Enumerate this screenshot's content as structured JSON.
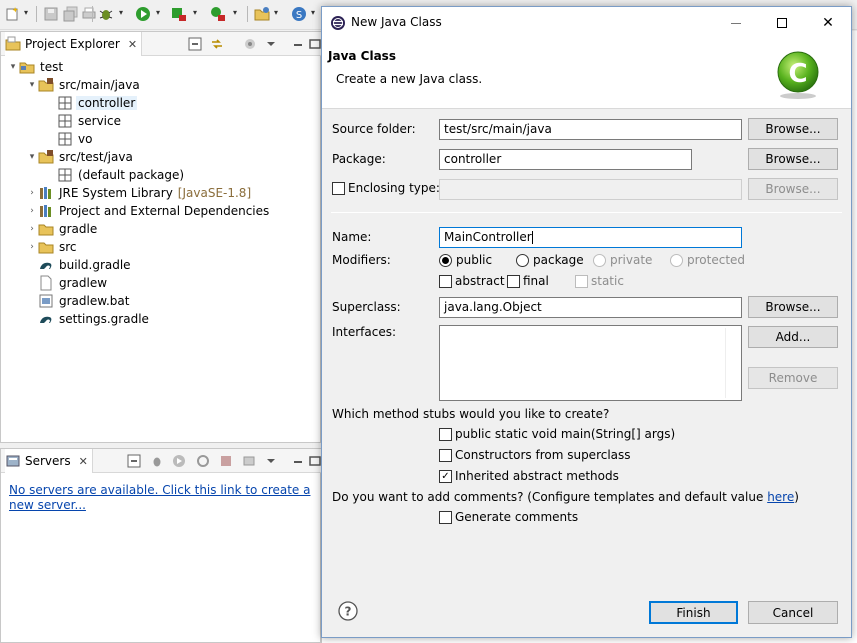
{
  "explorer": {
    "tab_label": "Project Explorer",
    "tree": [
      {
        "label": "test",
        "icon": "project-icon",
        "arrow": "▾",
        "level": 0
      },
      {
        "label": "src/main/java",
        "icon": "source-folder-icon",
        "arrow": "▾",
        "level": 1
      },
      {
        "label": "controller",
        "icon": "package-icon",
        "arrow": "",
        "level": 2,
        "selected": true
      },
      {
        "label": "service",
        "icon": "package-icon",
        "arrow": "",
        "level": 2
      },
      {
        "label": "vo",
        "icon": "package-icon",
        "arrow": "",
        "level": 2
      },
      {
        "label": "src/test/java",
        "icon": "source-folder-icon",
        "arrow": "▾",
        "level": 1
      },
      {
        "label": "(default package)",
        "icon": "package-icon",
        "arrow": "",
        "level": 2
      },
      {
        "label": "JRE System Library",
        "decor": "[JavaSE-1.8]",
        "icon": "library-icon",
        "arrow": "›",
        "level": 1
      },
      {
        "label": "Project and External Dependencies",
        "icon": "library-icon",
        "arrow": "›",
        "level": 1
      },
      {
        "label": "gradle",
        "icon": "folder-icon",
        "arrow": "›",
        "level": 1
      },
      {
        "label": "src",
        "icon": "folder-icon",
        "arrow": "›",
        "level": 1
      },
      {
        "label": "build.gradle",
        "icon": "gradle-file-icon",
        "arrow": "",
        "level": 1
      },
      {
        "label": "gradlew",
        "icon": "file-icon",
        "arrow": "",
        "level": 1
      },
      {
        "label": "gradlew.bat",
        "icon": "bat-file-icon",
        "arrow": "",
        "level": 1
      },
      {
        "label": "settings.gradle",
        "icon": "gradle-file-icon",
        "arrow": "",
        "level": 1
      }
    ]
  },
  "servers": {
    "tab_label": "Servers",
    "empty_link": "No servers are available. Click this link to create a new server..."
  },
  "dialog": {
    "window_title": "New Java Class",
    "banner_title": "Java Class",
    "banner_desc": "Create a new Java class.",
    "source_folder_label": "Source folder:",
    "source_folder_value": "test/src/main/java",
    "package_label": "Package:",
    "package_value": "controller",
    "enclosing_type_label": "Enclosing type:",
    "enclosing_type_value": "",
    "browse_label": "Browse...",
    "name_label": "Name:",
    "name_value": "MainController",
    "modifiers_label": "Modifiers:",
    "mod_public": "public",
    "mod_package": "package",
    "mod_private": "private",
    "mod_protected": "protected",
    "mod_abstract": "abstract",
    "mod_final": "final",
    "mod_static": "static",
    "superclass_label": "Superclass:",
    "superclass_value": "java.lang.Object",
    "interfaces_label": "Interfaces:",
    "add_label": "Add...",
    "remove_label": "Remove",
    "stubs_question": "Which method stubs would you like to create?",
    "stub_main": "public static void main(String[] args)",
    "stub_constructors": "Constructors from superclass",
    "stub_inherited": "Inherited abstract methods",
    "comments_question": "Do you want to add comments? (Configure templates and default value ",
    "comments_link": "here",
    "comments_close": ")",
    "generate_comments": "Generate comments",
    "finish_label": "Finish",
    "cancel_label": "Cancel"
  },
  "colors": {
    "accent": "#0078d7",
    "link": "#0645ad"
  }
}
